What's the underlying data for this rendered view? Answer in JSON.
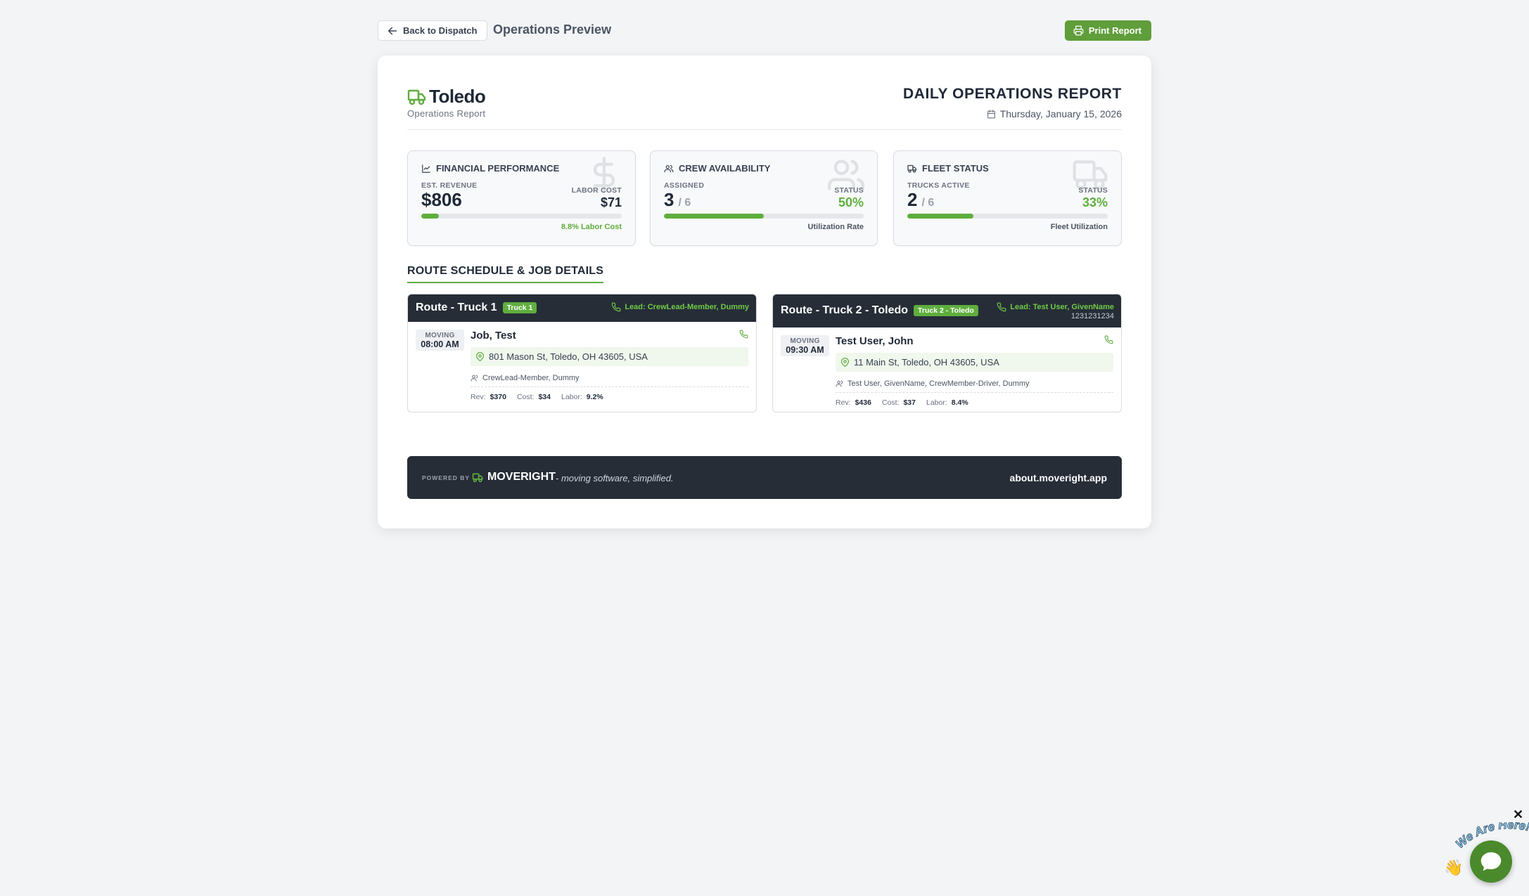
{
  "topbar": {
    "back_label": "Back to Dispatch",
    "title": "Operations Preview",
    "print_label": "Print Report"
  },
  "brand": {
    "name": "Toledo",
    "subtitle": "Operations Report"
  },
  "report": {
    "title": "DAILY OPERATIONS REPORT",
    "date": "Thursday, January 15, 2026"
  },
  "stats": {
    "financial": {
      "title": "FINANCIAL PERFORMANCE",
      "left_label": "EST. REVENUE",
      "left_value": "$806",
      "right_label": "LABOR COST",
      "right_value": "$71",
      "bar_percent": 8.8,
      "footer": "8.8% Labor Cost"
    },
    "crew": {
      "title": "CREW AVAILABILITY",
      "left_label": "ASSIGNED",
      "left_value": "3",
      "left_of": "/ 6",
      "right_label": "STATUS",
      "right_value": "50%",
      "bar_percent": 50,
      "footer": "Utilization Rate"
    },
    "fleet": {
      "title": "FLEET STATUS",
      "left_label": "TRUCKS ACTIVE",
      "left_value": "2",
      "left_of": "/ 6",
      "right_label": "STATUS",
      "right_value": "33%",
      "bar_percent": 33,
      "footer": "Fleet Utilization"
    }
  },
  "section_title": "ROUTE SCHEDULE & JOB DETAILS",
  "routes": [
    {
      "title": "Route - Truck 1",
      "badge": "Truck 1",
      "lead": "Lead: CrewLead-Member, Dummy",
      "phone": "",
      "job": {
        "type": "MOVING",
        "time": "08:00 AM",
        "name": "Job, Test",
        "address": "801 Mason St, Toledo, OH 43605, USA",
        "crew": "CrewLead-Member, Dummy",
        "rev_label": "Rev:",
        "rev": "$370",
        "cost_label": "Cost:",
        "cost": "$34",
        "labor_label": "Labor:",
        "labor": "9.2%"
      }
    },
    {
      "title": "Route - Truck 2 - Toledo",
      "badge": "Truck 2 - Toledo",
      "lead": "Lead: Test User, GivenName",
      "phone": "1231231234",
      "job": {
        "type": "MOVING",
        "time": "09:30 AM",
        "name": "Test User, John",
        "address": "11 Main St, Toledo, OH 43605, USA",
        "crew": "Test User, GivenName, CrewMember-Driver, Dummy",
        "rev_label": "Rev:",
        "rev": "$436",
        "cost_label": "Cost:",
        "cost": "$37",
        "labor_label": "Labor:",
        "labor": "8.4%"
      }
    }
  ],
  "footer": {
    "powered_by": "POWERED BY",
    "brand": "MOVERIGHT",
    "tagline": "- moving software, simplified.",
    "url": "about.moveright.app"
  },
  "chat": {
    "close": "✕",
    "label": "We Are Here!"
  },
  "colors": {
    "accent": "#5fae3e",
    "dark": "#262d37",
    "lead_green": "#6fca47"
  }
}
